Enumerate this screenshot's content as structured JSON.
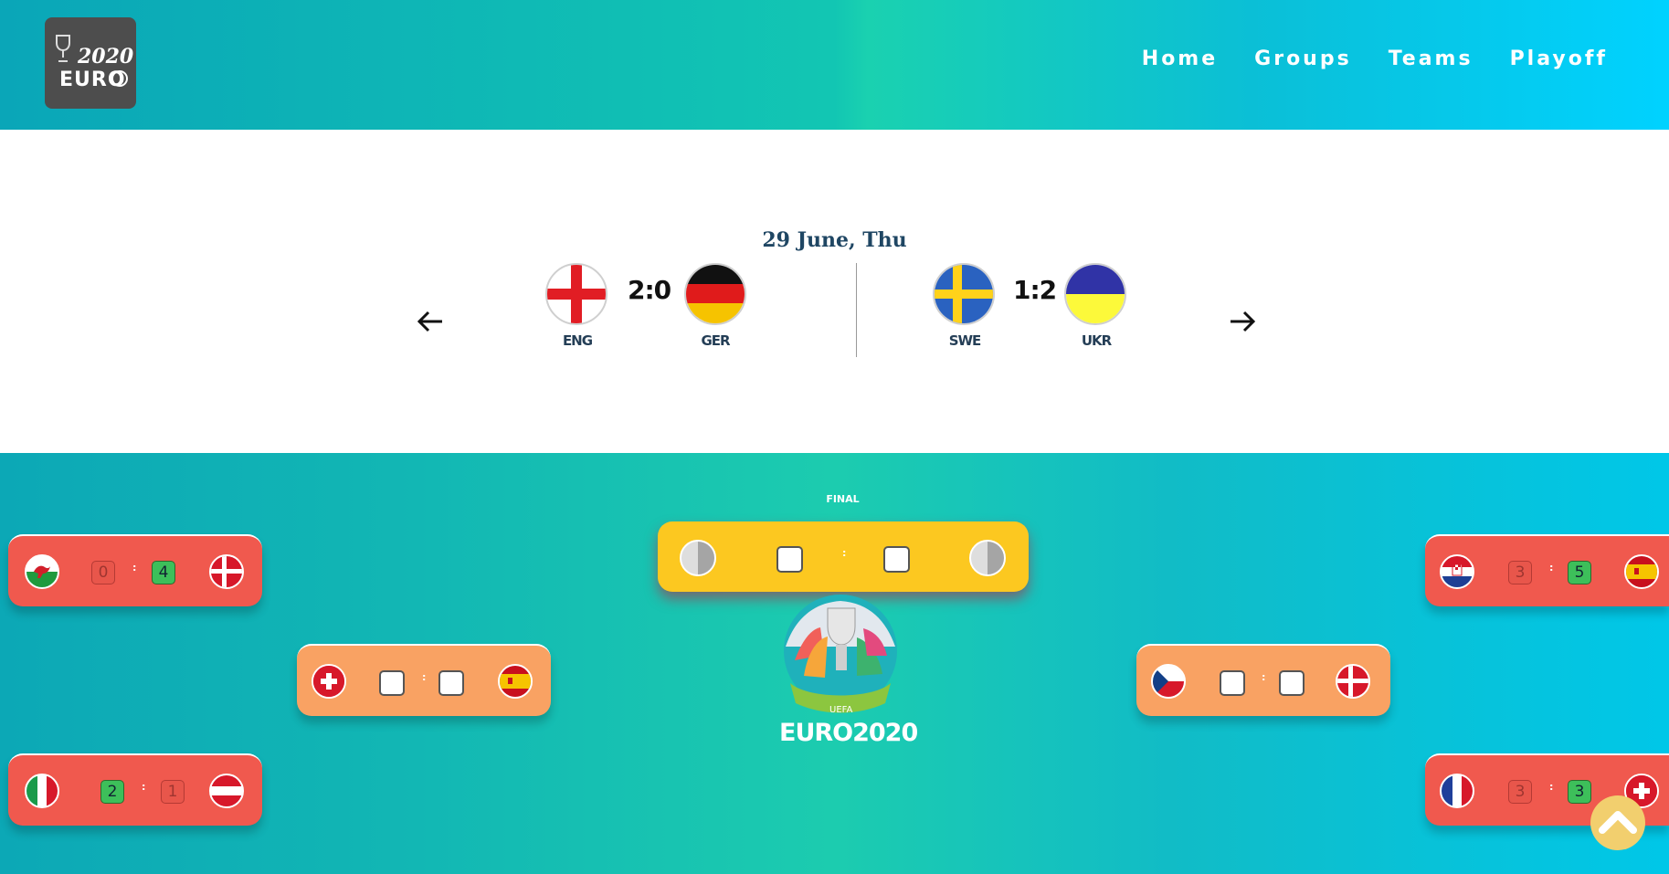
{
  "header": {
    "logo": {
      "year": "2020",
      "brand": "EURO"
    },
    "nav": [
      "Home",
      "Groups",
      "Teams",
      "Playoff"
    ]
  },
  "matches": {
    "date": "29 June, Thu",
    "games": [
      {
        "home": "ENG",
        "away": "GER",
        "score": "2:0"
      },
      {
        "home": "SWE",
        "away": "UKR",
        "score": "1:2"
      }
    ]
  },
  "bracket": {
    "final_label": "FINAL",
    "colon": ":",
    "left": [
      {
        "home": "wales-flag",
        "away": "denmark-flag",
        "home_score": "0",
        "away_score": "4"
      },
      {
        "home": "italy-flag",
        "away": "austria-flag",
        "home_score": "2",
        "away_score": "1"
      }
    ],
    "right": [
      {
        "home": "croatia-flag",
        "away": "spain-flag",
        "home_score": "3",
        "away_score": "5"
      },
      {
        "home": "france-flag",
        "away": "switzerland-flag",
        "home_score": "3",
        "away_score": "3"
      }
    ],
    "quarter_left": {
      "home": "switzerland-flag",
      "away": "spain-flag"
    },
    "quarter_right": {
      "home": "czech-flag",
      "away": "denmark-flag"
    },
    "euro_text": "EURO2020"
  },
  "colors": {
    "red_card": "#f0594e",
    "orange_card": "#f9a263",
    "final_card": "#fcc820",
    "win": "#3dbf5a"
  }
}
